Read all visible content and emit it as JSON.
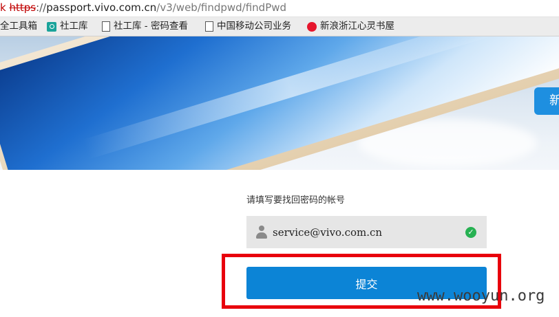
{
  "browser": {
    "url": {
      "prefix": "k ",
      "protocol": "https",
      "separator": "://",
      "host": "passport.vivo.com.cn",
      "path": "/v3/web/findpwd/findPwd"
    },
    "bookmarks": [
      {
        "label": "全工具箱",
        "icon": "none"
      },
      {
        "label": "社工库",
        "icon": "tool-icon"
      },
      {
        "label": "社工库 - 密码查看",
        "icon": "page-icon"
      },
      {
        "label": "中国移动公司业务",
        "icon": "page-icon"
      },
      {
        "label": "新浪浙江心灵书屋",
        "icon": "weibo-icon"
      }
    ]
  },
  "banner": {
    "button_label": "新"
  },
  "form": {
    "prompt": "请填写要找回密码的帐号",
    "account_value": "service@vivo.com.cn",
    "valid_icon": "check-circle-icon",
    "submit_label": "提交"
  },
  "watermark": "www.wooyun.org",
  "colors": {
    "submit_button": "#0c84d6",
    "highlight_box": "#e8000c",
    "valid_check": "#27b152"
  }
}
